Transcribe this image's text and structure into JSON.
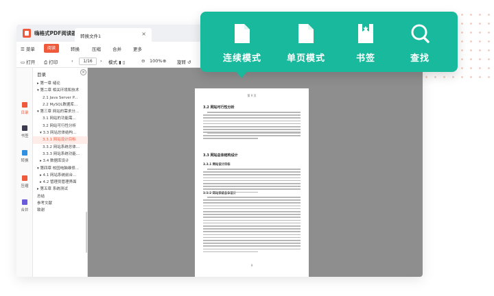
{
  "app": {
    "title": "嗨格式PDF阅读器",
    "doc_tab": "转换文件1",
    "tab_close": "×"
  },
  "menu": {
    "menu_label": "☰ 菜单",
    "items": [
      "阅读",
      "转换",
      "压缩",
      "合并",
      "更多"
    ]
  },
  "toolbar": {
    "open": "打开",
    "print": "打印",
    "page": "1/16",
    "mode": "模式",
    "zoom": "100%",
    "rotate": "旋转"
  },
  "rail": [
    {
      "label": "目录",
      "color": "#ef5a3c"
    },
    {
      "label": "书签",
      "color": "#3b3b4f"
    },
    {
      "label": "转换",
      "color": "#2f8fe0"
    },
    {
      "label": "压缩",
      "color": "#ef5a3c"
    },
    {
      "label": "合并",
      "color": "#6a5cd8"
    }
  ],
  "sidebar": {
    "title": "目录",
    "close": "×",
    "items": [
      "▸ 第一章 绪论",
      "▾ 第二章 相关环境和技术",
      "2.1 Java Server P...",
      "2.2 MySQL数据库...",
      "▾ 第三章 网站的需求分...",
      "3.1 网站的功能需...",
      "3.2 网站可行性分析",
      "▾ 3.3 网站总体结构...",
      "3.3.1 网站设计目标",
      "3.3.2 网站系统总体...",
      "3.3.3 网站系统功能...",
      "▸ 3.4 数据库设计",
      "▾ 第四章 校园电脑维修...",
      "▸ 4.1 网站系统前台...",
      "▸ 4.2 管理员管理界面",
      "▸ 第五章 系统测试",
      "总结",
      "参考文献",
      "致谢"
    ],
    "selected_index": 8
  },
  "document": {
    "header": "第 9 页",
    "sections": [
      {
        "kind": "heading",
        "text": "3.2 网站可行性分析"
      },
      {
        "kind": "heading",
        "text": "3.3 网站总体结构设计"
      },
      {
        "kind": "subheading",
        "text": "3.3.1 网站设计目标"
      },
      {
        "kind": "subheading",
        "text": "3.3.2 网站系统总体设计"
      }
    ],
    "footer": "9"
  },
  "popup": {
    "color": "#19b99d",
    "items": [
      {
        "label": "连续模式",
        "icon": "continuous-mode-icon"
      },
      {
        "label": "单页模式",
        "icon": "single-page-icon"
      },
      {
        "label": "书签",
        "icon": "bookmark-icon"
      },
      {
        "label": "查找",
        "icon": "search-icon"
      }
    ]
  }
}
